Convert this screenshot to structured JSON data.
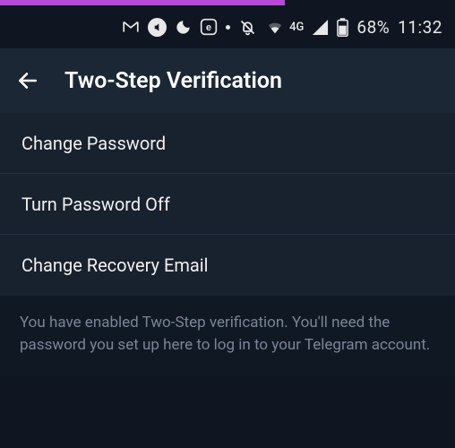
{
  "status": {
    "network_label": "4G",
    "battery_pct": "68%",
    "time": "11:32"
  },
  "header": {
    "title": "Two-Step Verification"
  },
  "list": {
    "items": [
      {
        "label": "Change Password"
      },
      {
        "label": "Turn Password Off"
      },
      {
        "label": "Change Recovery Email"
      }
    ]
  },
  "footer": {
    "text": "You have enabled Two-Step verification. You'll need the password you set up here to log in to your Telegram account."
  }
}
